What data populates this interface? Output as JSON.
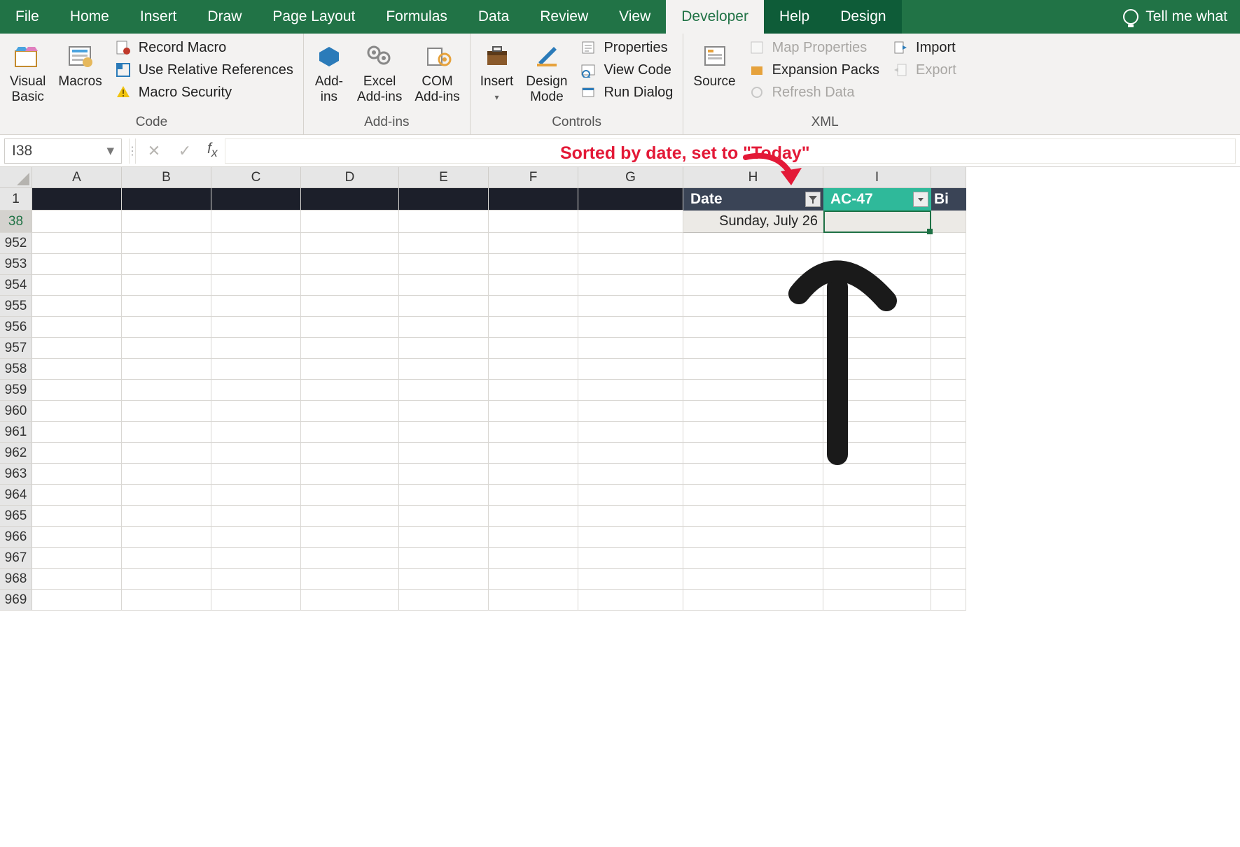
{
  "tabs": {
    "file": "File",
    "home": "Home",
    "insert": "Insert",
    "draw": "Draw",
    "page_layout": "Page Layout",
    "formulas": "Formulas",
    "data": "Data",
    "review": "Review",
    "view": "View",
    "developer": "Developer",
    "help": "Help",
    "design": "Design",
    "tellme": "Tell me what"
  },
  "ribbon": {
    "code": {
      "visual_basic": "Visual\nBasic",
      "macros": "Macros",
      "record_macro": "Record Macro",
      "use_relative": "Use Relative References",
      "macro_security": "Macro Security",
      "group": "Code"
    },
    "addins": {
      "addins": "Add-\nins",
      "excel_addins": "Excel\nAdd-ins",
      "com_addins": "COM\nAdd-ins",
      "group": "Add-ins"
    },
    "controls": {
      "insert": "Insert",
      "design_mode": "Design\nMode",
      "properties": "Properties",
      "view_code": "View Code",
      "run_dialog": "Run Dialog",
      "group": "Controls"
    },
    "xml": {
      "source": "Source",
      "map_properties": "Map Properties",
      "expansion_packs": "Expansion Packs",
      "refresh_data": "Refresh Data",
      "import": "Import",
      "export": "Export",
      "group": "XML"
    }
  },
  "formula_bar": {
    "name_box": "I38",
    "value": ""
  },
  "annotation": {
    "text": "Sorted by date, set to \"Today\""
  },
  "grid": {
    "columns": [
      "A",
      "B",
      "C",
      "D",
      "E",
      "F",
      "G",
      "H",
      "I"
    ],
    "header_row": {
      "date": "Date",
      "ac47": "AC-47",
      "bi": "Bi"
    },
    "row1_num": "1",
    "row38_num": "38",
    "date_value": "Sunday, July 26",
    "rows": [
      "952",
      "953",
      "954",
      "955",
      "956",
      "957",
      "958",
      "959",
      "960",
      "961",
      "962",
      "963",
      "964",
      "965",
      "966",
      "967",
      "968",
      "969"
    ]
  }
}
